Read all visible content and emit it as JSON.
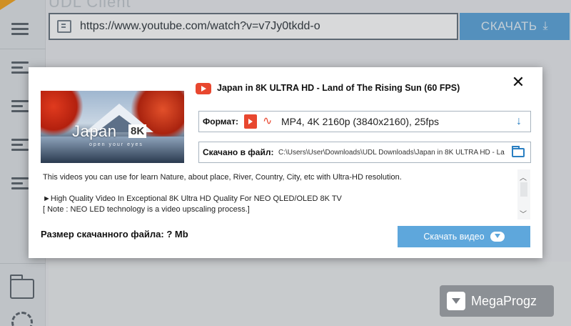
{
  "app": {
    "title": "UDL Client"
  },
  "url_bar": {
    "value": "https://www.youtube.com/watch?v=v7Jy0tkdd-o"
  },
  "top_download_button": {
    "label": "СКАЧАТЬ",
    "icon": "download-arrow-icon"
  },
  "sidebar": {
    "icons": [
      "menu-icon",
      "list-icon",
      "list-icon",
      "list-icon",
      "list-icon",
      "folder-icon",
      "gear-icon"
    ]
  },
  "dialog": {
    "close_icon": "close-icon",
    "thumbnail": {
      "title": "Japan",
      "badge": "8K",
      "subtitle": "open your eyes"
    },
    "video_title": "Japan in 8K ULTRA HD - Land of The Rising Sun (60 FPS)",
    "format": {
      "label": "Формат:",
      "value": "MP4, 4K 2160p (3840x2160), 25fps"
    },
    "path": {
      "label": "Скачано в файл:",
      "value": "C:\\Users\\User\\Downloads\\UDL Downloads\\Japan in 8K ULTRA HD - La"
    },
    "description": {
      "line1": "This videos you can use for learn  Nature, about place,  River, Country, City,  etc with Ultra-HD resolution.",
      "line2": "►High Quality Video In Exceptional 8K Ultra HD Quality For NEO QLED/OLED 8K TV",
      "line3": "[ Note : NEO LED technology is a video upscaling process.]"
    },
    "file_size_label": "Размер скачанного файла: ? Mb",
    "download_button": {
      "label": "Скачать видео",
      "icon": "cloud-download-icon"
    }
  },
  "watermark": {
    "text": "MegaProgz"
  },
  "colors": {
    "accent": "#5ea7dc",
    "youtube_red": "#e8472f",
    "link_blue": "#2a7fc2"
  }
}
